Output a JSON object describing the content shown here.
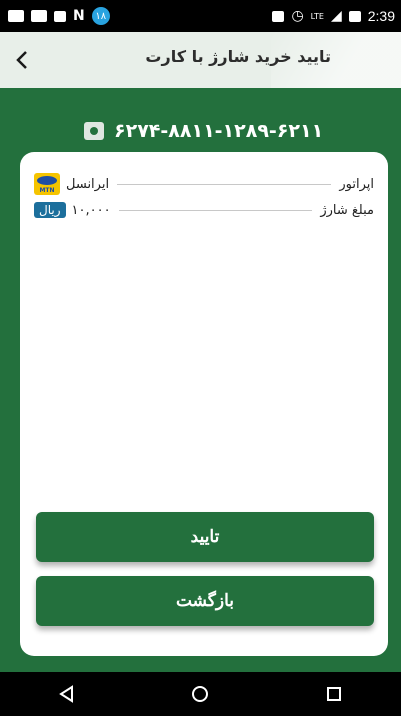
{
  "status_bar": {
    "notification_count": "۱۸",
    "lte_label": "LTE",
    "time": "2:39"
  },
  "header": {
    "title": "تایید خرید شارژ با کارت",
    "back_icon": "chevron-left-icon"
  },
  "card": {
    "icon": "safe-icon",
    "number": "۶۲۷۴-۸۸۱۱-۱۲۸۹-۶۲۱۱"
  },
  "details": {
    "operator_label": "اپراتور",
    "operator_value": "ایرانسل",
    "operator_logo_text": "MTN",
    "amount_label": "مبلغ شارژ",
    "amount_value": "۱۰,۰۰۰",
    "currency": "ریال"
  },
  "buttons": {
    "confirm": "تایید",
    "back": "بازگشت"
  },
  "colors": {
    "primary_green": "#23703d",
    "header_bg": "#e8efe9",
    "currency_badge": "#1c6f9c",
    "mtn_yellow": "#f5c400"
  }
}
